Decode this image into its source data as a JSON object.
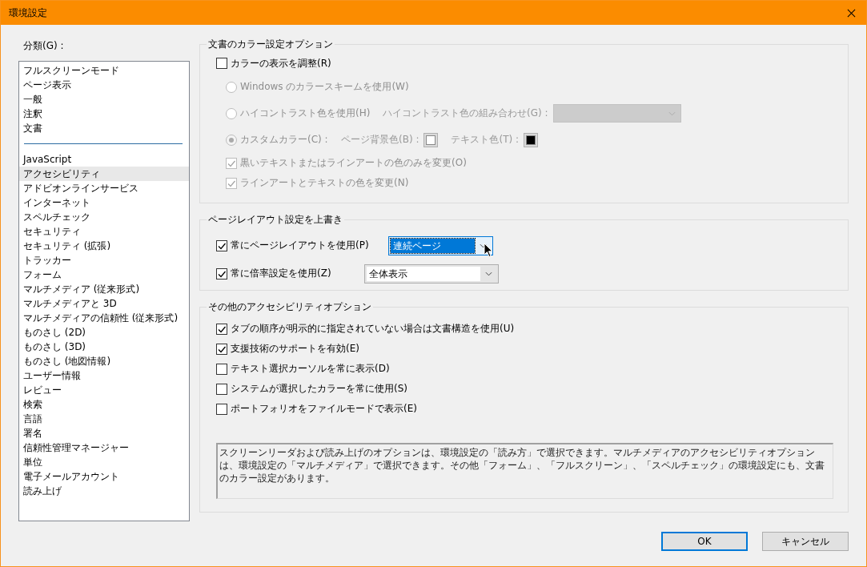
{
  "window": {
    "title": "環境設定"
  },
  "sidebar": {
    "label": "分類(G) :",
    "groups": [
      [
        {
          "label": "フルスクリーンモード",
          "selected": false
        },
        {
          "label": "ページ表示",
          "selected": false
        },
        {
          "label": "一般",
          "selected": false
        },
        {
          "label": "注釈",
          "selected": false
        },
        {
          "label": "文書",
          "selected": false
        }
      ],
      [
        {
          "label": "JavaScript",
          "selected": false
        },
        {
          "label": "アクセシビリティ",
          "selected": true
        },
        {
          "label": "アドビオンラインサービス",
          "selected": false
        },
        {
          "label": "インターネット",
          "selected": false
        },
        {
          "label": "スペルチェック",
          "selected": false
        },
        {
          "label": "セキュリティ",
          "selected": false
        },
        {
          "label": "セキュリティ (拡張)",
          "selected": false
        },
        {
          "label": "トラッカー",
          "selected": false
        },
        {
          "label": "フォーム",
          "selected": false
        },
        {
          "label": "マルチメディア (従来形式)",
          "selected": false
        },
        {
          "label": "マルチメディアと 3D",
          "selected": false
        },
        {
          "label": "マルチメディアの信頼性 (従来形式)",
          "selected": false
        },
        {
          "label": "ものさし (2D)",
          "selected": false
        },
        {
          "label": "ものさし (3D)",
          "selected": false
        },
        {
          "label": "ものさし (地図情報)",
          "selected": false
        },
        {
          "label": "ユーザー情報",
          "selected": false
        },
        {
          "label": "レビュー",
          "selected": false
        },
        {
          "label": "検索",
          "selected": false
        },
        {
          "label": "言語",
          "selected": false
        },
        {
          "label": "署名",
          "selected": false
        },
        {
          "label": "信頼性管理マネージャー",
          "selected": false
        },
        {
          "label": "単位",
          "selected": false
        },
        {
          "label": "電子メールアカウント",
          "selected": false
        },
        {
          "label": "読み上げ",
          "selected": false
        }
      ]
    ]
  },
  "color_options": {
    "title": "文書のカラー設定オプション",
    "options": [
      {
        "kind": "checkbox",
        "label": "カラーの表示を調整(R)",
        "checked": false,
        "disabled": false
      },
      {
        "kind": "radio",
        "label": "Windows のカラースキームを使用(W)",
        "selected": false,
        "disabled": true
      },
      {
        "kind": "radio",
        "label": "ハイコントラスト色を使用(H)",
        "selected": false,
        "disabled": true,
        "combo_label": "ハイコントラスト色の組み合わせ(G) :"
      },
      {
        "kind": "radio",
        "label": "カスタムカラー(C) :",
        "selected": true,
        "disabled": true,
        "swatches": [
          {
            "label": "ページ背景色(B) :",
            "color": "#ffffff"
          },
          {
            "label": "テキスト色(T) :",
            "color": "#000000"
          }
        ]
      },
      {
        "kind": "checkbox",
        "label": "黒いテキストまたはラインアートの色のみを変更(O)",
        "checked": true,
        "disabled": true
      },
      {
        "kind": "checkbox",
        "label": "ラインアートとテキストの色を変更(N)",
        "checked": true,
        "disabled": true
      }
    ]
  },
  "page_layout": {
    "title": "ページレイアウト設定を上書き",
    "options": [
      {
        "label": "常にページレイアウトを使用(P)",
        "checked": true,
        "value": "連続ページ",
        "focused": true
      },
      {
        "label": "常に倍率設定を使用(Z)",
        "checked": true,
        "value": "全体表示",
        "focused": false
      }
    ]
  },
  "other_options": {
    "title": "その他のアクセシビリティオプション",
    "options": [
      {
        "label": "タブの順序が明示的に指定されていない場合は文書構造を使用(U)",
        "checked": true
      },
      {
        "label": "支援技術のサポートを有効(E)",
        "checked": true
      },
      {
        "label": "テキスト選択カーソルを常に表示(D)",
        "checked": false
      },
      {
        "label": "システムが選択したカラーを常に使用(S)",
        "checked": false
      },
      {
        "label": "ポートフォリオをファイルモードで表示(E)",
        "checked": false
      }
    ],
    "note": "スクリーンリーダおよび読み上げのオプションは、環境設定の「読み方」で選択できます。マルチメディアのアクセシビリティオプションは、環境設定の「マルチメディア」で選択できます。その他「フォーム」、「フルスクリーン」、「スペルチェック」の環境設定にも、文書のカラー設定があります。"
  },
  "buttons": [
    "OK",
    "キャンセル"
  ]
}
